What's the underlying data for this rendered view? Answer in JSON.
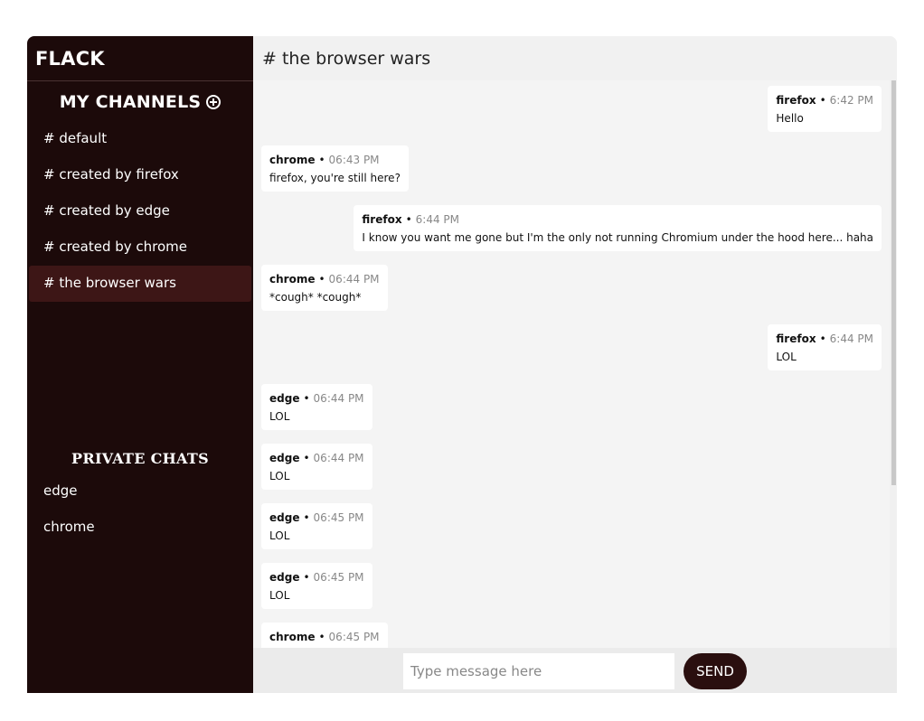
{
  "app": {
    "brand": "FLACK"
  },
  "sidebar": {
    "channels_title": "MY CHANNELS",
    "channels": [
      {
        "label": "# default",
        "active": false
      },
      {
        "label": "# created by firefox",
        "active": false
      },
      {
        "label": "# created by edge",
        "active": false
      },
      {
        "label": "# created by chrome",
        "active": false
      },
      {
        "label": "# the browser wars",
        "active": true
      }
    ],
    "private_title": "PRIVATE CHATS",
    "private_chats": [
      "edge",
      "chrome"
    ]
  },
  "channel": {
    "title": "# the browser wars"
  },
  "messages": [
    {
      "author": "firefox",
      "time": "6:42 PM",
      "text": "Hello",
      "mine": true
    },
    {
      "author": "chrome",
      "time": "06:43 PM",
      "text": "firefox, you're still here?",
      "mine": false
    },
    {
      "author": "firefox",
      "time": "6:44 PM",
      "text": "I know you want me gone but I'm the only not running Chromium under the hood here... haha",
      "mine": true
    },
    {
      "author": "chrome",
      "time": "06:44 PM",
      "text": "*cough* *cough*",
      "mine": false
    },
    {
      "author": "firefox",
      "time": "6:44 PM",
      "text": "LOL",
      "mine": true
    },
    {
      "author": "edge",
      "time": "06:44 PM",
      "text": "LOL",
      "mine": false
    },
    {
      "author": "edge",
      "time": "06:44 PM",
      "text": "LOL",
      "mine": false
    },
    {
      "author": "edge",
      "time": "06:45 PM",
      "text": "LOL",
      "mine": false
    },
    {
      "author": "edge",
      "time": "06:45 PM",
      "text": "LOL",
      "mine": false
    },
    {
      "author": "chrome",
      "time": "06:45 PM",
      "text": "",
      "mine": false
    }
  ],
  "composer": {
    "placeholder": "Type message here",
    "send_label": "SEND"
  },
  "colors": {
    "sidebar_bg": "#1c0a0a",
    "active_channel": "#3d1616",
    "send_button": "#2a0f0f"
  }
}
